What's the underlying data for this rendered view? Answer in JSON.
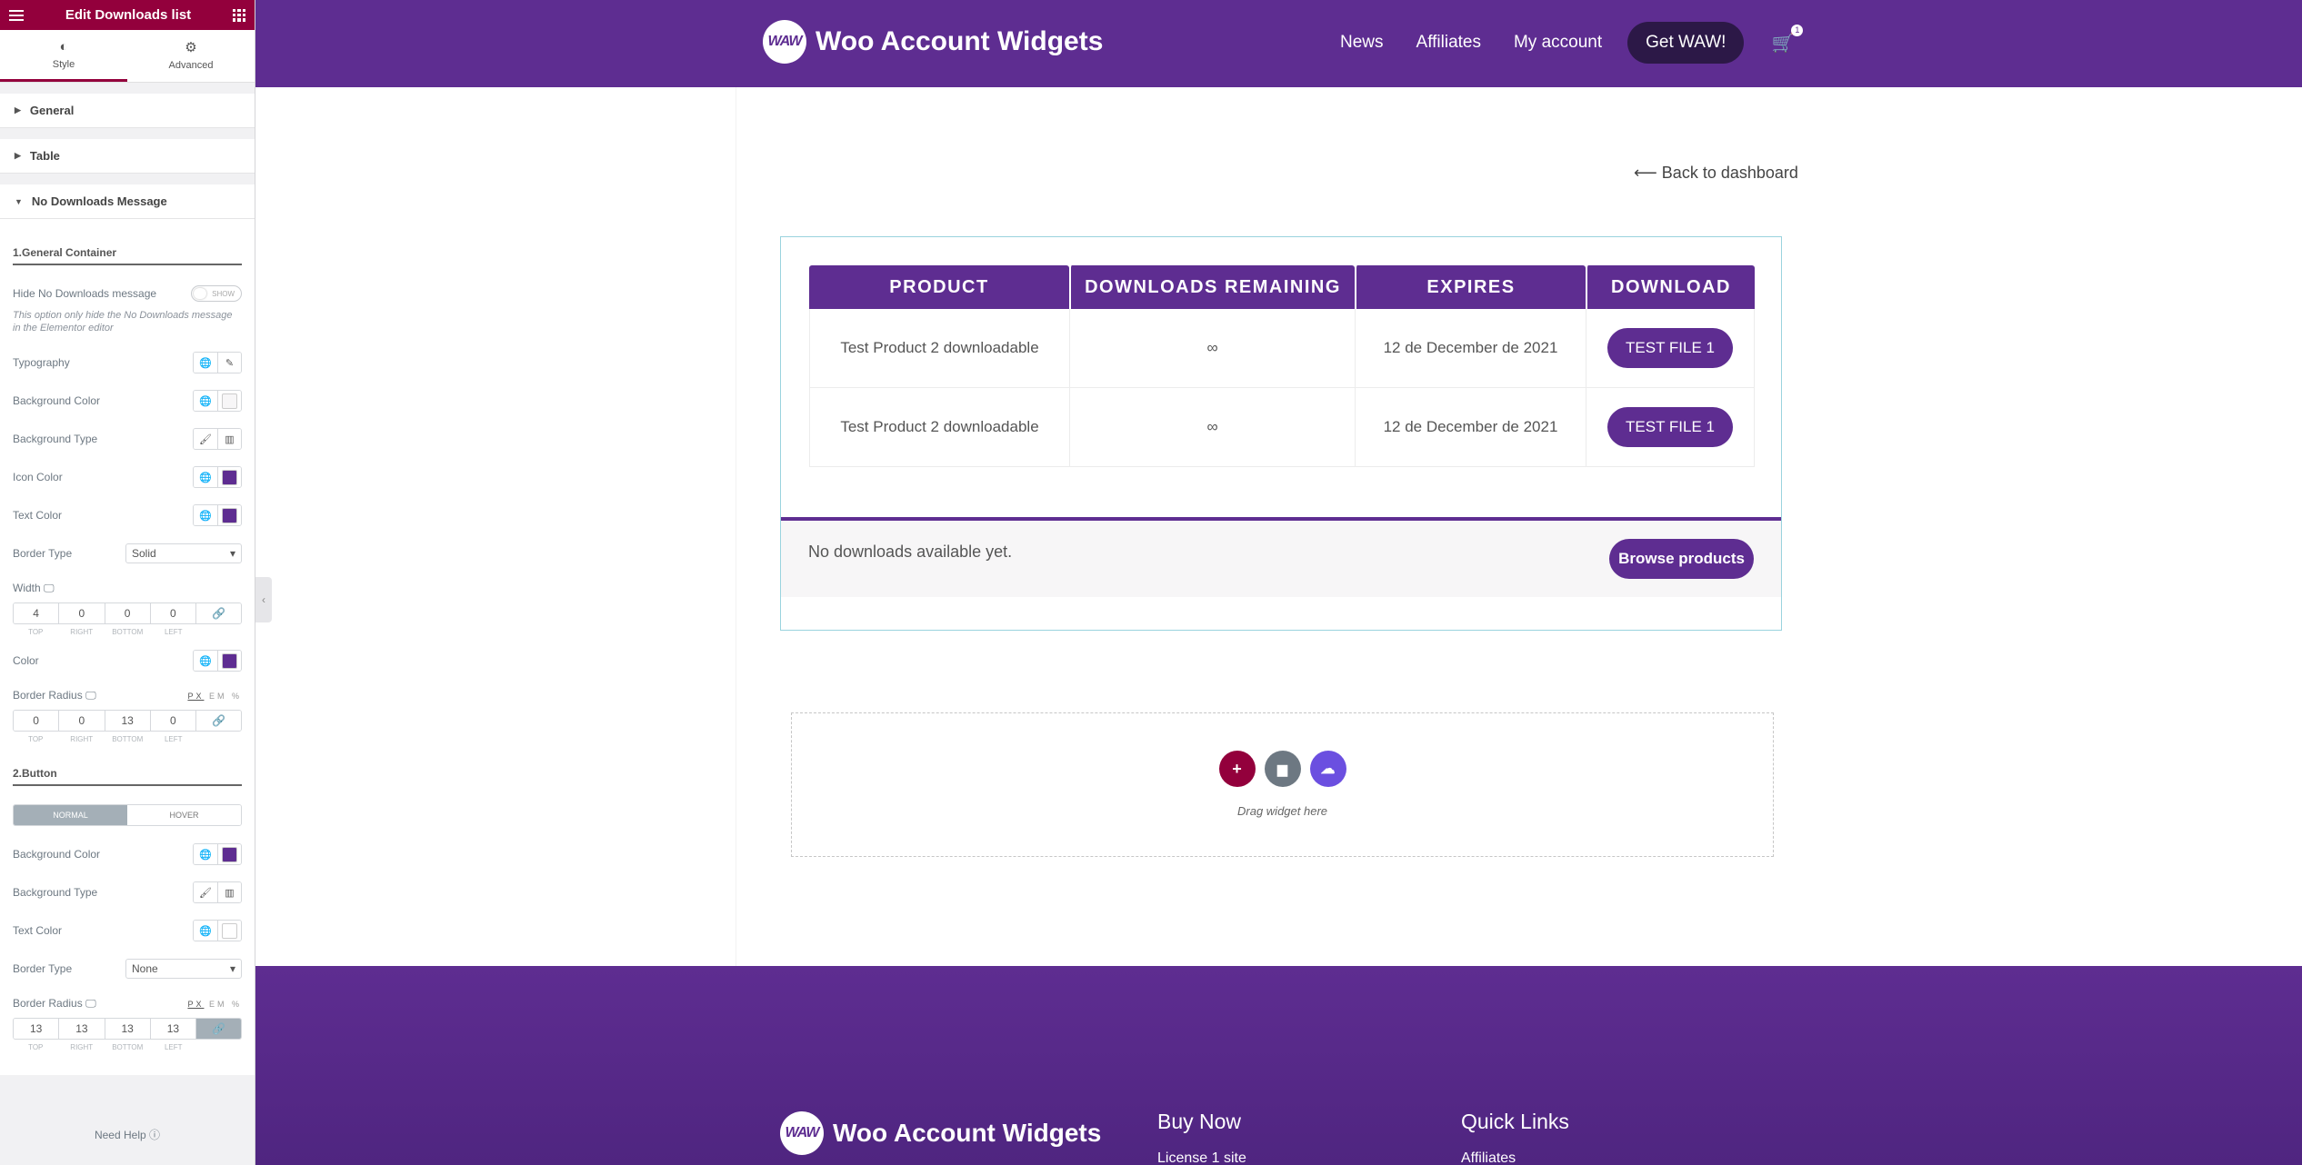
{
  "panel": {
    "title": "Edit Downloads list",
    "tabs": [
      {
        "label": "Style"
      },
      {
        "label": "Advanced"
      }
    ],
    "sections": {
      "general": "General",
      "table": "Table",
      "no_downloads": "No Downloads Message"
    },
    "general_container": {
      "heading": "1.General Container",
      "hide_label": "Hide No Downloads message",
      "toggle_text": "SHOW",
      "hide_note": "This option only hide the No Downloads message in the Elementor editor",
      "typography": "Typography",
      "bg_color": "Background Color",
      "bg_type": "Background Type",
      "icon_color": "Icon Color",
      "text_color": "Text Color",
      "border_type": "Border Type",
      "border_type_value": "Solid",
      "width_label": "Width",
      "width_values": [
        "4",
        "0",
        "0",
        "0"
      ],
      "color_label": "Color",
      "radius_label": "Border Radius",
      "radius_values": [
        "0",
        "0",
        "13",
        "0"
      ],
      "dim_labels": [
        "TOP",
        "RIGHT",
        "BOTTOM",
        "LEFT"
      ],
      "units": [
        "PX",
        "EM",
        "%"
      ]
    },
    "button_section": {
      "heading": "2.Button",
      "tab_normal": "NORMAL",
      "tab_hover": "HOVER",
      "bg_color": "Background Color",
      "bg_type": "Background Type",
      "text_color": "Text Color",
      "border_type": "Border Type",
      "border_type_value": "None",
      "radius_label": "Border Radius",
      "radius_values": [
        "13",
        "13",
        "13",
        "13"
      ]
    },
    "need_help": "Need Help"
  },
  "colors": {
    "brand_purple": "#5e2d91",
    "elementor_red": "#93003c",
    "dark_cta": "#2c1847"
  },
  "site": {
    "logo_badge": "WAW",
    "logo_text": "Woo Account Widgets",
    "nav": [
      {
        "label": "News"
      },
      {
        "label": "Affiliates"
      },
      {
        "label": "My account"
      }
    ],
    "cta": "Get WAW!",
    "cart_count": "1",
    "back_link": "⟵ Back to dashboard",
    "table": {
      "headers": [
        "PRODUCT",
        "DOWNLOADS REMAINING",
        "EXPIRES",
        "DOWNLOAD"
      ],
      "rows": [
        {
          "product": "Test Product 2 downloadable",
          "remaining": "∞",
          "expires": "12 de December de 2021",
          "file": "TEST FILE 1"
        },
        {
          "product": "Test Product 2 downloadable",
          "remaining": "∞",
          "expires": "12 de December de 2021",
          "file": "TEST FILE 1"
        }
      ]
    },
    "no_downloads_msg": "No downloads available yet.",
    "browse_button": "Browse products",
    "drop_hint": "Drag widget here",
    "footer": {
      "buy_now": "Buy Now",
      "buy_link": "License 1 site",
      "quick_links": "Quick Links",
      "quick_link": "Affiliates"
    }
  }
}
